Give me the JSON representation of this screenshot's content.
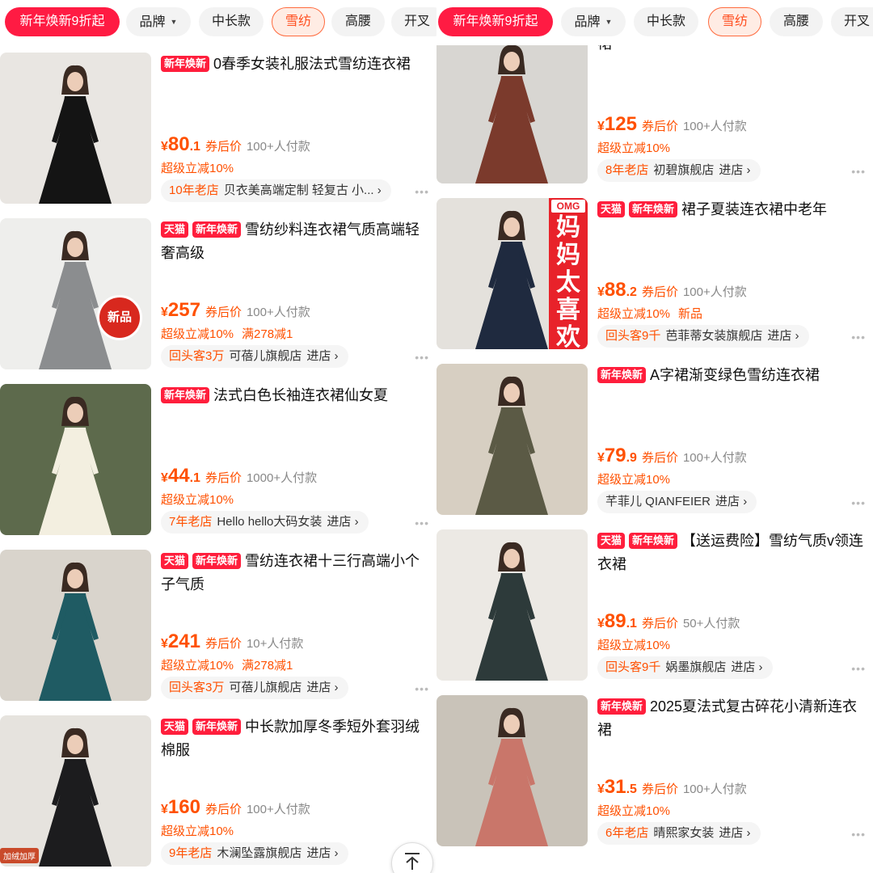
{
  "filters": {
    "promo": "新年焕新9折起",
    "brand": "品牌",
    "length": "中长款",
    "material": "雪纺",
    "waist": "高腰",
    "slit": "开叉"
  },
  "left_items": [
    {
      "tags": [
        "新年焕新"
      ],
      "title": "0春季女装礼服法式雪纺连衣裙",
      "price_int": "80",
      "price_dec": ".1",
      "price_label": "券后价",
      "sales": "100+人付款",
      "promos": [
        "超级立减10%"
      ],
      "shop_badge": "10年老店",
      "shop_name": "贝衣美高端定制 轻复古 小...",
      "shop_enter": "",
      "image_colors": [
        "#e9e6e2",
        "#141414"
      ]
    },
    {
      "tags": [
        "天猫",
        "新年焕新"
      ],
      "title": "雪纺纱料连衣裙气质高端轻奢高级",
      "price_int": "257",
      "price_dec": "",
      "price_label": "券后价",
      "sales": "100+人付款",
      "promos": [
        "超级立减10%",
        "满278减1"
      ],
      "shop_badge": "回头客3万",
      "shop_name": "可蓓儿旗舰店",
      "shop_enter": "进店",
      "image_badge": "新品",
      "image_colors": [
        "#eeeeec",
        "#8b8d8f"
      ]
    },
    {
      "tags": [
        "新年焕新"
      ],
      "title": "法式白色长袖连衣裙仙女夏",
      "price_int": "44",
      "price_dec": ".1",
      "price_label": "券后价",
      "sales": "1000+人付款",
      "promos": [
        "超级立减10%"
      ],
      "shop_badge": "7年老店",
      "shop_name": "Hello hello大码女装",
      "shop_enter": "进店",
      "image_colors": [
        "#5d6a4c",
        "#f3efe0"
      ]
    },
    {
      "tags": [
        "天猫",
        "新年焕新"
      ],
      "title": "雪纺连衣裙十三行高端小个子气质",
      "price_int": "241",
      "price_dec": "",
      "price_label": "券后价",
      "sales": "10+人付款",
      "promos": [
        "超级立减10%",
        "满278减1"
      ],
      "shop_badge": "回头客3万",
      "shop_name": "可蓓儿旗舰店",
      "shop_enter": "进店",
      "image_colors": [
        "#d9d4cc",
        "#1f5b63"
      ]
    },
    {
      "tags": [
        "天猫",
        "新年焕新"
      ],
      "title": "中长款加厚冬季短外套羽绒棉服",
      "price_int": "160",
      "price_dec": "",
      "price_label": "券后价",
      "sales": "100+人付款",
      "promos": [
        "超级立减10%"
      ],
      "shop_badge": "9年老店",
      "shop_name": "木澜坠露旗舰店",
      "shop_enter": "进店",
      "image_tag": "加绒加厚",
      "image_colors": [
        "#e6e3de",
        "#1c1c1e"
      ]
    }
  ],
  "right_items": [
    {
      "tags": [],
      "title": "裙",
      "price_int": "125",
      "price_dec": "",
      "price_label": "券后价",
      "sales": "100+人付款",
      "promos": [
        "超级立减10%"
      ],
      "shop_badge": "8年老店",
      "shop_name": "初碧旗舰店",
      "shop_enter": "进店",
      "image_colors": [
        "#d8d6d2",
        "#7b3a2c"
      ]
    },
    {
      "tags": [
        "天猫",
        "新年焕新"
      ],
      "title": "裙子夏装连衣裙中老年",
      "price_int": "88",
      "price_dec": ".2",
      "price_label": "券后价",
      "sales": "100+人付款",
      "promos": [
        "超级立减10%",
        "新品"
      ],
      "shop_badge": "回头客9千",
      "shop_name": "芭菲蒂女装旗舰店",
      "shop_enter": "进店",
      "banner_top": "OMG",
      "banner_text": "妈妈太喜欢了",
      "image_colors": [
        "#e4e1dc",
        "#1f2a3f"
      ]
    },
    {
      "tags": [
        "新年焕新"
      ],
      "title": "A字裙渐变绿色雪纺连衣裙",
      "price_int": "79",
      "price_dec": ".9",
      "price_label": "券后价",
      "sales": "100+人付款",
      "promos": [
        "超级立减10%"
      ],
      "shop_badge": "",
      "shop_name": "芊菲儿 QIANFEIER",
      "shop_enter": "进店",
      "image_colors": [
        "#d7cfc2",
        "#5b5a45"
      ]
    },
    {
      "tags": [
        "天猫",
        "新年焕新"
      ],
      "title": "【送运费险】雪纺气质v领连衣裙",
      "price_int": "89",
      "price_dec": ".1",
      "price_label": "券后价",
      "sales": "50+人付款",
      "promos": [
        "超级立减10%"
      ],
      "shop_badge": "回头客9千",
      "shop_name": "娲墨旗舰店",
      "shop_enter": "进店",
      "image_colors": [
        "#ece9e4",
        "#2d3a3a"
      ]
    },
    {
      "tags": [
        "新年焕新"
      ],
      "title": "2025夏法式复古碎花小清新连衣裙",
      "price_int": "31",
      "price_dec": ".5",
      "price_label": "券后价",
      "sales": "100+人付款",
      "promos": [
        "超级立减10%"
      ],
      "shop_badge": "6年老店",
      "shop_name": "晴熙家女装",
      "shop_enter": "进店",
      "image_colors": [
        "#c9c3b9",
        "#c9766a"
      ]
    }
  ],
  "currency": "¥",
  "more_glyph": "•••",
  "accent": "#ff5000",
  "brand_red": "#ff1b43"
}
